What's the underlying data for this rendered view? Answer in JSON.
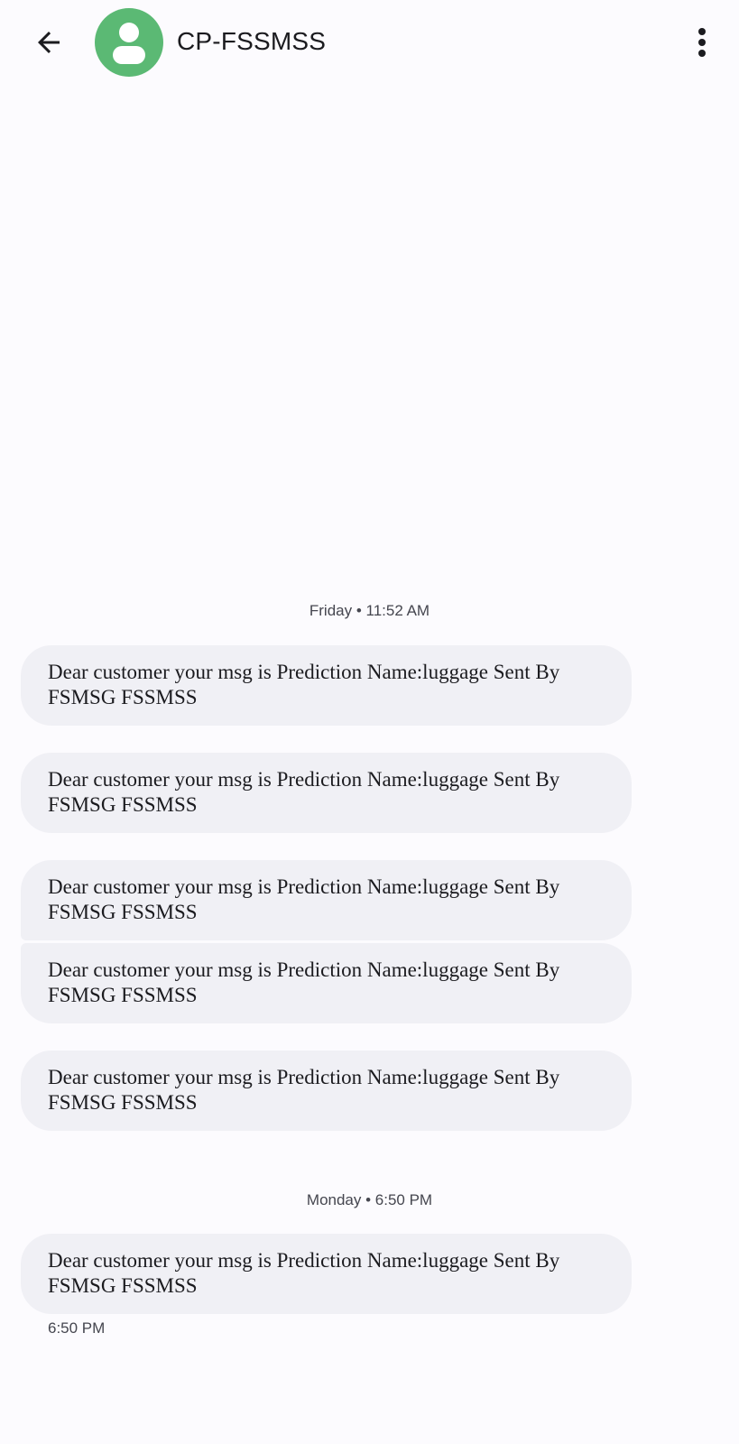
{
  "header": {
    "back_icon": "arrow-left-icon",
    "avatar_icon": "person-icon",
    "avatar_color": "#5bb974",
    "contact_name": "CP-FSSMSS",
    "menu_icon": "more-vert-icon"
  },
  "conversation": {
    "groups": [
      {
        "date_label": "Friday • 11:52 AM",
        "messages": [
          {
            "text": "Dear customer your msg is Prediction Name:luggage  Sent By FSMSG FSSMSS"
          },
          {
            "text": "Dear customer your msg is Prediction Name:luggage  Sent By FSMSG FSSMSS"
          },
          {
            "text": "Dear customer your msg is Prediction Name:luggage  Sent By FSMSG FSSMSS"
          },
          {
            "text": "Dear customer your msg is Prediction Name:luggage  Sent By FSMSG FSSMSS"
          },
          {
            "text": "Dear customer your msg is Prediction Name:luggage  Sent By FSMSG FSSMSS"
          }
        ]
      },
      {
        "date_label": "Monday • 6:50 PM",
        "messages": [
          {
            "text": "Dear customer your msg is Prediction Name:luggage  Sent By FSMSG FSSMSS"
          }
        ],
        "last_timestamp": "6:50 PM"
      }
    ]
  },
  "colors": {
    "background": "#fcfbfe",
    "bubble": "#f0f0f5",
    "text": "#1b1b1f",
    "secondary_text": "#45464f"
  }
}
